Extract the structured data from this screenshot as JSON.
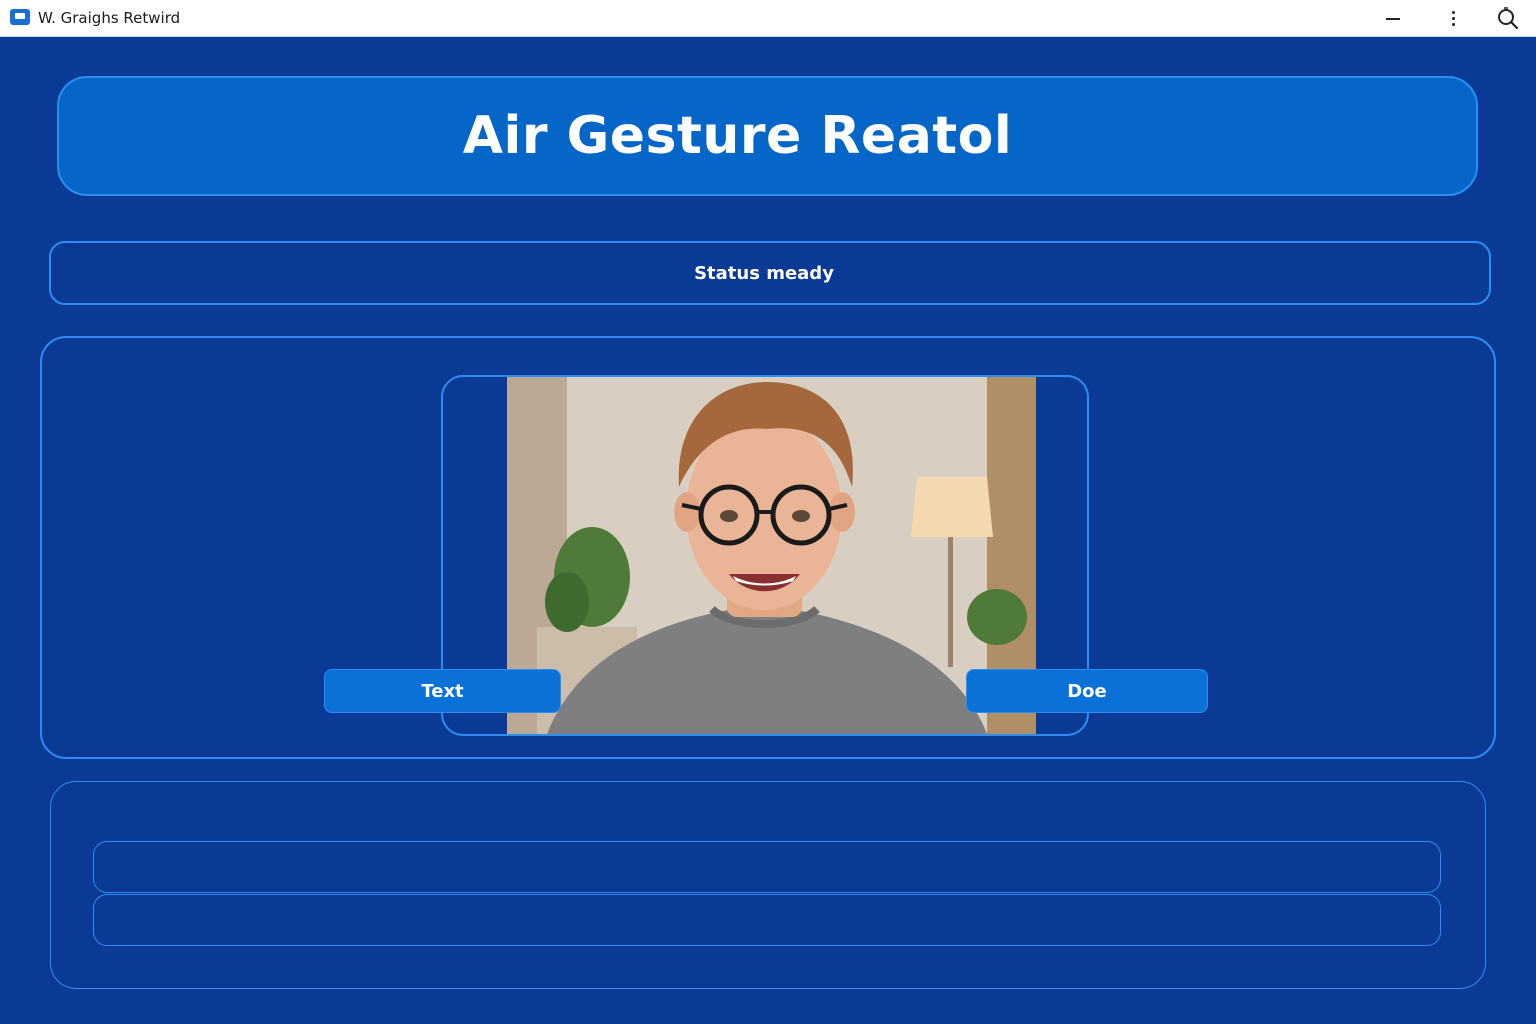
{
  "window": {
    "title": "W. Graighs Retwird"
  },
  "header": {
    "title": "Air Gesture Reatol"
  },
  "status": {
    "text": "Status meady"
  },
  "camera": {
    "buttons": {
      "left_label": "Text",
      "right_label": "Doe"
    }
  },
  "output": {
    "line1_value": "",
    "line2_value": ""
  },
  "icons": {
    "app": "app-window-icon",
    "minimize": "minimize-icon",
    "more": "more-vertical-icon",
    "search": "search-icon"
  },
  "colors": {
    "background": "#0a3a95",
    "accent": "#0566c8",
    "border": "#2e8df0",
    "button": "#0a72d6",
    "text": "#ffffff"
  }
}
